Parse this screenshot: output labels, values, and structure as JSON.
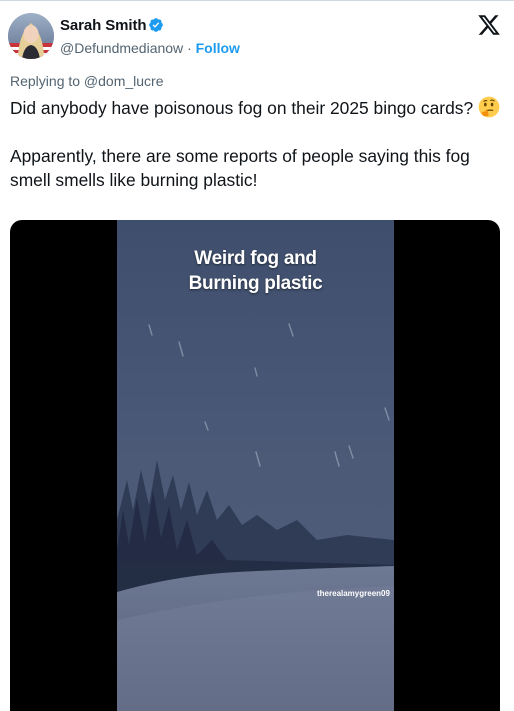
{
  "author": {
    "display_name": "Sarah Smith",
    "handle": "@Defundmedianow",
    "separator": "·",
    "follow_label": "Follow",
    "verified": true
  },
  "reply": {
    "text": "Replying to @dom_lucre"
  },
  "tweet": {
    "paragraph1": "Did anybody have poisonous fog on their 2025 bingo cards?",
    "paragraph2": "Apparently, there are some reports of people saying this fog smell smells like burning plastic!",
    "emoji": "thinking-face"
  },
  "media": {
    "type": "video",
    "overlay_title_line1": "Weird fog and",
    "overlay_title_line2": "Burning plastic",
    "watermark": "therealamygreen09"
  },
  "colors": {
    "accent": "#1d9bf0",
    "text": "#0f1419",
    "secondary": "#536471"
  }
}
